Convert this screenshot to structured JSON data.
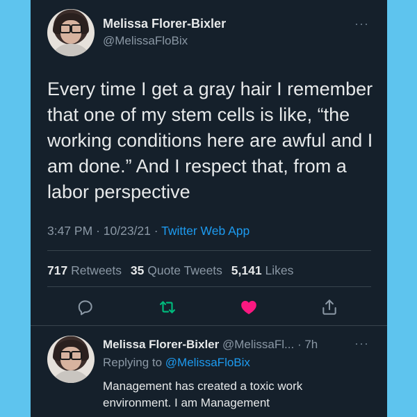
{
  "tweet": {
    "author_name": "Melissa Florer-Bixler",
    "author_handle": "@MelissaFloBix",
    "more_icon": "more-horizontal-icon",
    "text": "Every time I get a gray hair I remember that one of my stem cells is like, “the working conditions here are awful and I am done.” And I respect that, from a labor perspective",
    "time": "3:47 PM",
    "date": "10/23/21",
    "app": "Twitter Web App",
    "separator": "·"
  },
  "stats": {
    "retweets_count": "717",
    "retweets_label": "Retweets",
    "quotes_count": "35",
    "quotes_label": "Quote Tweets",
    "likes_count": "5,141",
    "likes_label": "Likes"
  },
  "actions": {
    "reply_icon": "reply-icon",
    "retweet_icon": "retweet-icon",
    "like_icon": "heart-icon",
    "share_icon": "share-icon",
    "like_color": "#f91880",
    "retweet_color": "#00ba7c",
    "icon_color": "#8b98a5"
  },
  "reply": {
    "author_name": "Melissa Florer-Bixler",
    "author_handle": "@MelissaFl...",
    "time": "· 7h",
    "replying_to_label": "Replying to",
    "replying_to_handle": "@MelissaFloBix",
    "text": "Management has created a toxic work environment. I am Management"
  },
  "colors": {
    "background": "#5ec4ee",
    "card": "#15202b",
    "text": "#e7e9ea",
    "secondary": "#8b98a5",
    "accent": "#1d9bf0"
  }
}
